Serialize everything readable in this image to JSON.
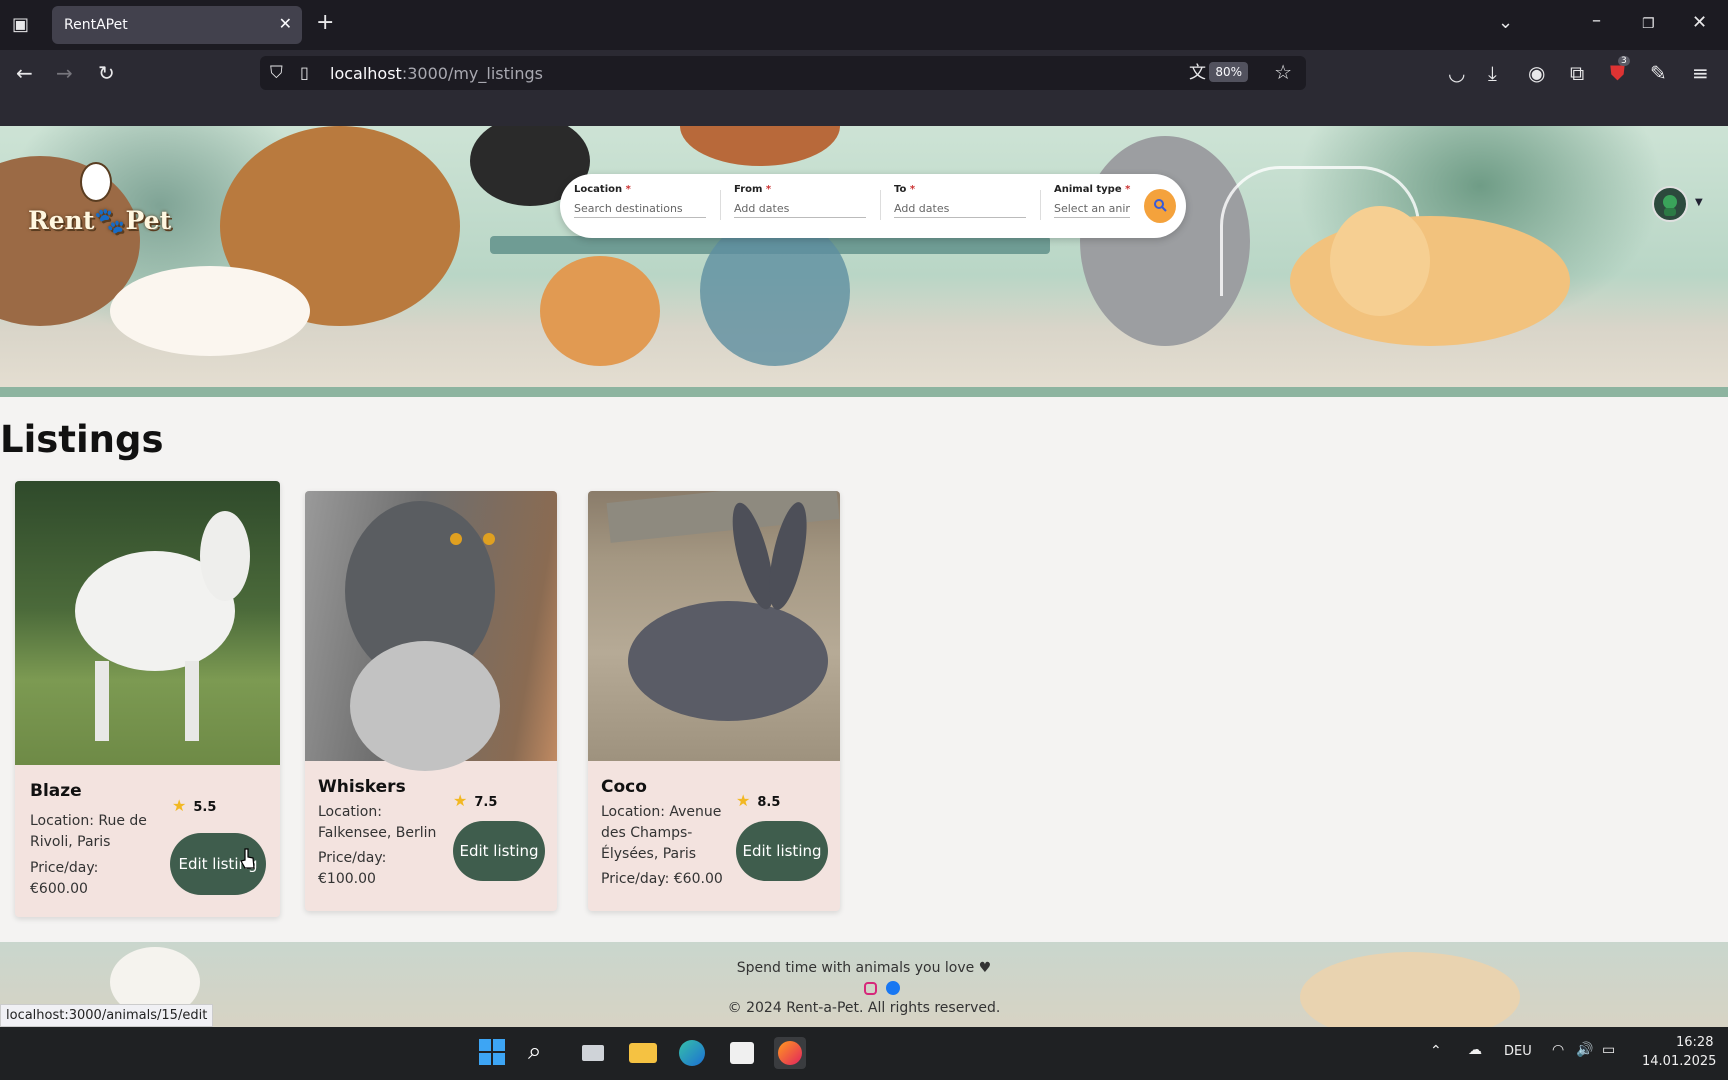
{
  "browser": {
    "tab_title": "RentAPet",
    "tab_close": "✕",
    "new_tab": "+",
    "url_host": "localhost",
    "url_path": ":3000/my_listings",
    "zoom": "80%",
    "extension_badge": "3"
  },
  "search": {
    "location_label": "Location",
    "location_placeholder": "Search destinations",
    "from_label": "From",
    "from_placeholder": "Add dates",
    "to_label": "To",
    "to_placeholder": "Add dates",
    "animal_label": "Animal type",
    "animal_placeholder": "Select an animal",
    "required_mark": "*"
  },
  "logo": {
    "text": "Rent🐾Pet"
  },
  "page": {
    "heading": "Listings"
  },
  "listings": [
    {
      "name": "Blaze",
      "rating": "5.5",
      "location": "Location: Rue de Rivoli, Paris",
      "price": "Price/day: €600.00",
      "edit": "Edit listing"
    },
    {
      "name": "Whiskers",
      "rating": "7.5",
      "location": "Location: Falkensee, Berlin",
      "price": "Price/day: €100.00",
      "edit": "Edit listing"
    },
    {
      "name": "Coco",
      "rating": "8.5",
      "location": "Location: Avenue des Champs-Élysées, Paris",
      "price": "Price/day: €60.00",
      "edit": "Edit listing"
    }
  ],
  "footer": {
    "tagline": "Spend time with animals you love ♥",
    "copyright": "© 2024 Rent-a-Pet. All rights reserved."
  },
  "status_bar": {
    "hover_url": "localhost:3000/animals/15/edit"
  },
  "taskbar": {
    "language": "DEU",
    "time": "16:28",
    "date": "14.01.2025"
  },
  "colors": {
    "accent_orange": "#f4a23c",
    "button_green": "#3f5d4d",
    "card_bg": "#f3e3df",
    "star": "#f2b823"
  }
}
